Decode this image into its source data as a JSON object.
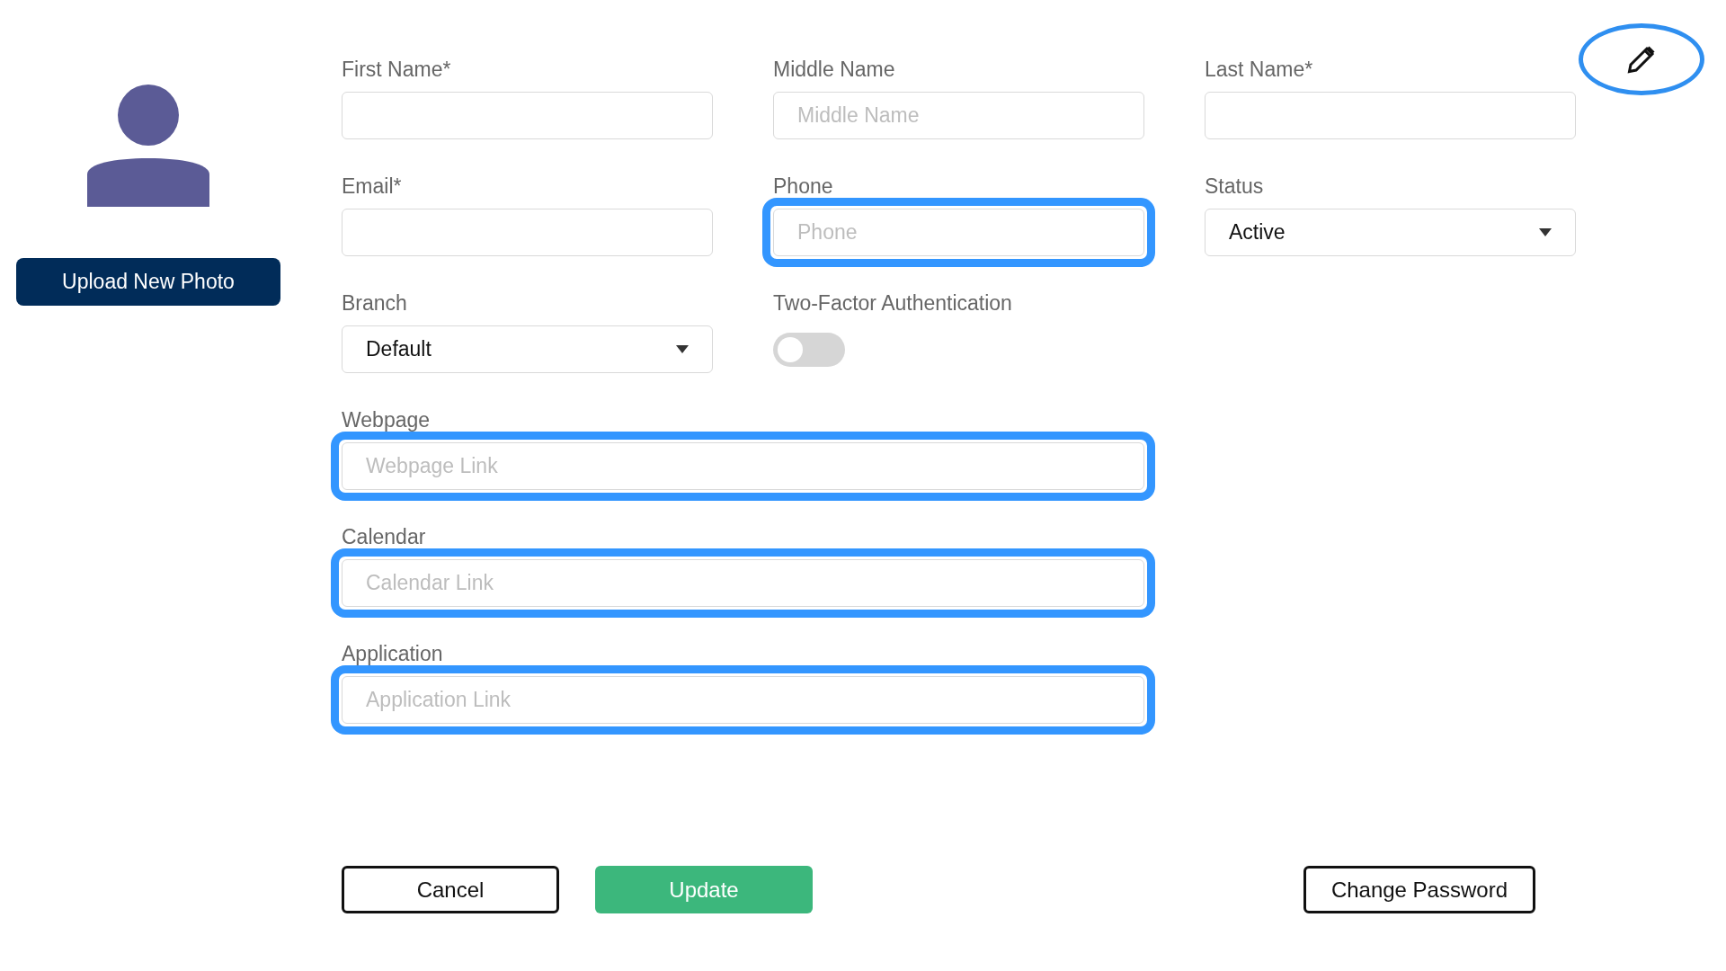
{
  "profile": {
    "upload_button": "Upload New Photo"
  },
  "edit_button": {
    "circled": true
  },
  "fields": [
    {
      "label": "First Name*",
      "kind": "text",
      "wide": false,
      "highlighted": false
    },
    {
      "label": "Middle Name",
      "kind": "text",
      "placeholder": "Middle Name",
      "wide": false,
      "highlighted": false
    },
    {
      "label": "Last Name*",
      "kind": "text",
      "wide": false,
      "highlighted": false
    },
    {
      "label": "Email*",
      "kind": "text",
      "wide": false,
      "highlighted": false
    },
    {
      "label": "Phone",
      "kind": "text",
      "placeholder": "Phone",
      "wide": false,
      "highlighted": true
    },
    {
      "label": "Status",
      "kind": "select",
      "value": "Active",
      "wide": false,
      "highlighted": false
    },
    {
      "label": "Branch",
      "kind": "select",
      "value": "Default",
      "wide": false,
      "highlighted": false
    },
    {
      "label": "Two-Factor Authentication",
      "kind": "toggle",
      "on": false,
      "wide": false,
      "highlighted": false
    },
    {
      "label": "Webpage",
      "kind": "text",
      "placeholder": "Webpage Link",
      "wide": true,
      "highlighted": true
    },
    {
      "label": "Calendar",
      "kind": "text",
      "placeholder": "Calendar Link",
      "wide": true,
      "highlighted": true
    },
    {
      "label": "Application",
      "kind": "text",
      "placeholder": "Application Link",
      "wide": true,
      "highlighted": true
    }
  ],
  "buttons": [
    {
      "label": "Cancel",
      "kind": "outline"
    },
    {
      "label": "Update",
      "kind": "primary"
    }
  ],
  "change_password": {
    "label": "Change Password"
  }
}
